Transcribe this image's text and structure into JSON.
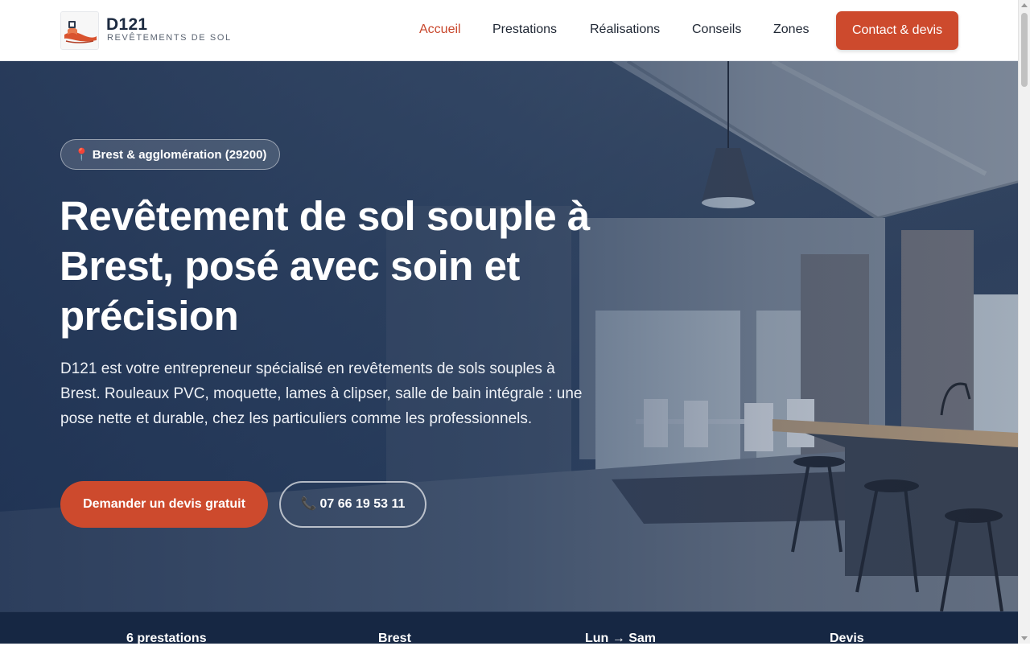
{
  "brand": {
    "name": "D121",
    "tagline": "REVÊTEMENTS DE SOL",
    "logo_icon": "flooring-roll-logo"
  },
  "nav": {
    "items": [
      {
        "label": "Accueil",
        "active": true
      },
      {
        "label": "Prestations",
        "active": false
      },
      {
        "label": "Réalisations",
        "active": false
      },
      {
        "label": "Conseils",
        "active": false
      },
      {
        "label": "Zones",
        "active": false
      }
    ],
    "cta_label": "Contact & devis"
  },
  "hero": {
    "location_icon": "pin-icon",
    "location_badge": "Brest & agglomération (29200)",
    "title": "Revêtement de sol souple à Brest, posé avec soin et précision",
    "description": "D121 est votre entrepreneur spécialisé en revêtements de sols souples à Brest. Rouleaux PVC, moquette, lames à clipser, salle de bain intégrale : une pose nette et durable, chez les particuliers comme les professionnels.",
    "primary_button": "Demander un devis gratuit",
    "phone_icon": "phone-icon",
    "phone_button": "07 66 19 53 11"
  },
  "stats": [
    {
      "label": "6 prestations"
    },
    {
      "label": "Brest"
    },
    {
      "label": "Lun → Sam"
    },
    {
      "label": "Devis"
    }
  ],
  "colors": {
    "accent": "#cd4a2d",
    "nav_active": "#c8462b",
    "hero_overlay": "#1c3052",
    "stats_bg": "#162743"
  }
}
